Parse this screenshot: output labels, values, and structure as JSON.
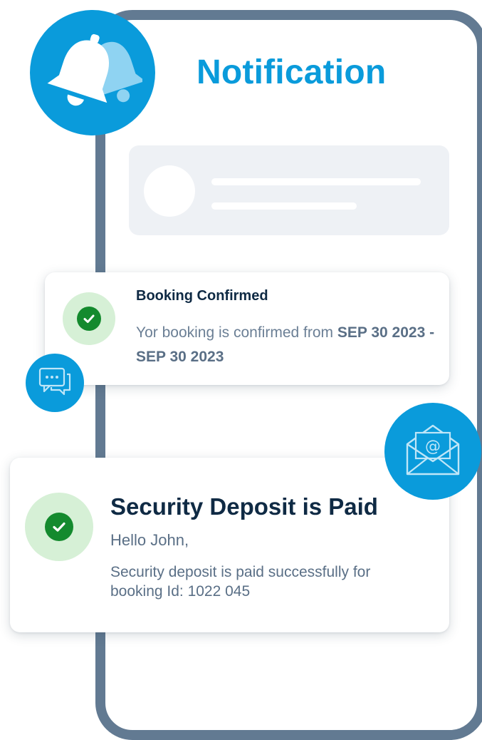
{
  "header": {
    "title": "Notification"
  },
  "icons": {
    "bell": "bell-icon",
    "chat": "chat-icon",
    "mail": "mail-icon",
    "check": "check-icon"
  },
  "colors": {
    "accent": "#0a9bdb",
    "frame": "#627a92",
    "success_bg": "#d6f0d6",
    "success": "#148a2e",
    "heading": "#0f2a44",
    "muted": "#6b7f95"
  },
  "notifications": [
    {
      "title": "Booking Confirmed",
      "message_prefix": "Yor booking is confirmed from ",
      "message_bold": "SEP 30 2023 - SEP 30 2023"
    },
    {
      "title": "Security Deposit is Paid",
      "greeting": "Hello John,",
      "message": "Security deposit is paid successfully for booking Id: 1022 045"
    }
  ]
}
